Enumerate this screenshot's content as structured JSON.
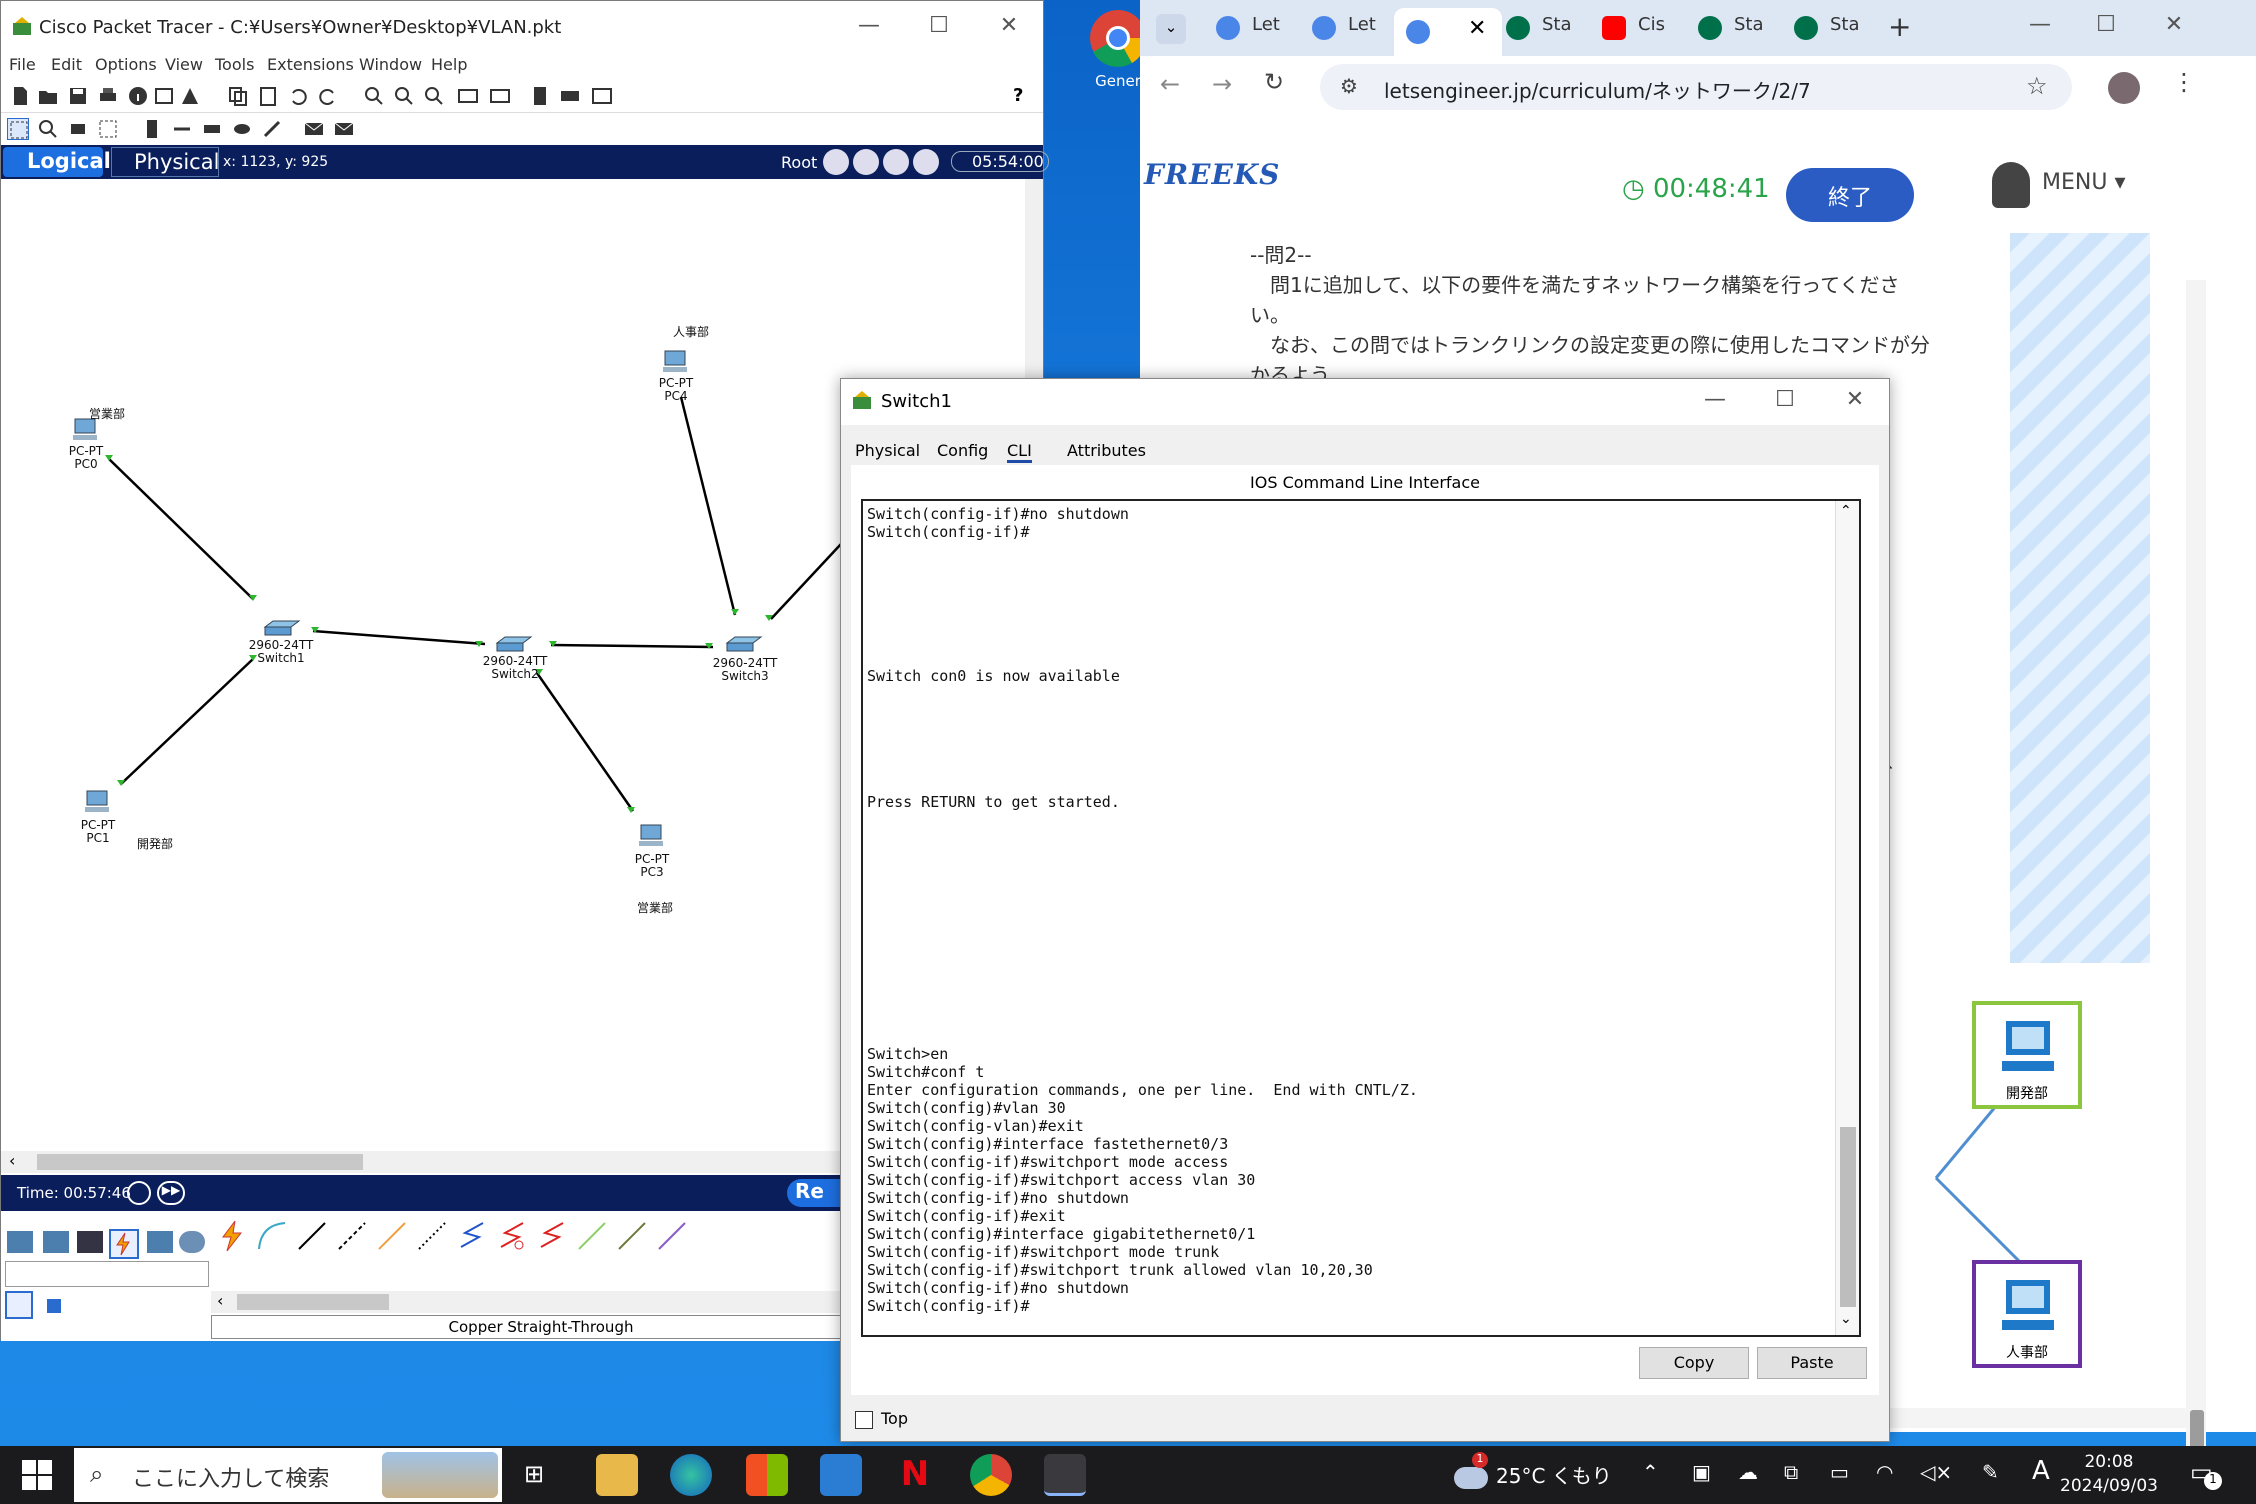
{
  "desktop": {
    "chrome_icon_label": "Gener"
  },
  "packet_tracer": {
    "title": "Cisco Packet Tracer - C:¥Users¥Owner¥Desktop¥VLAN.pkt",
    "menu": [
      "File",
      "Edit",
      "Options",
      "View",
      "Tools",
      "Extensions",
      "Window",
      "Help"
    ],
    "tab_logical": "Logical",
    "tab_physical": "Physical",
    "coords": "x: 1123, y: 925",
    "root": "Root",
    "clock": "05:54:00",
    "time": "Time: 00:57:46",
    "realtime_partial": "Re",
    "cable_label": "Copper Straight-Through",
    "devices": [
      {
        "model": "PC-PT",
        "name": "PC0",
        "dept": "営業部"
      },
      {
        "model": "PC-PT",
        "name": "PC1",
        "dept": "開発部"
      },
      {
        "model": "PC-PT",
        "name": "PC3",
        "dept": "営業部"
      },
      {
        "model": "PC-PT",
        "name": "PC4",
        "dept": "人事部"
      },
      {
        "model": "2960-24TT",
        "name": "Switch1"
      },
      {
        "model": "2960-24TT",
        "name": "Switch2"
      },
      {
        "model": "2960-24TT",
        "name": "Switch3"
      }
    ]
  },
  "chrome": {
    "tabs": [
      "Let",
      "Let",
      "",
      "Sta",
      "Cis",
      "Sta",
      "Sta"
    ],
    "url": "letsengineer.jp/curriculum/ネットワーク/2/7",
    "logo": "FREEKS",
    "timer": "00:48:41",
    "end_button": "終了",
    "menu_label": "MENU",
    "question_title": "--問2--",
    "question_line1": "問1に追加して、以下の要件を満たすネットワーク構築を行ってくださ",
    "question_line2": "い。",
    "question_line3": "なお、この問ではトランクリンクの設定変更の際に使用したコマンドが分",
    "question_line4": "かるよう",
    "fragment": "、",
    "netbox_dev": "開発部",
    "netbox_hr": "人事部",
    "colors": {
      "dev_border": "#8cc63f",
      "hr_border": "#6a2fa0",
      "link": "#4f8fd0"
    }
  },
  "switch_dialog": {
    "title": "Switch1",
    "tabs": [
      "Physical",
      "Config",
      "CLI",
      "Attributes"
    ],
    "active_tab": "CLI",
    "header": "IOS Command Line Interface",
    "cli_text": "Switch(config-if)#no shutdown\nSwitch(config-if)#\n\n\n\n\n\n\n\nSwitch con0 is now available\n\n\n\n\n\n\nPress RETURN to get started.\n\n\n\n\n\n\n\n\n\n\n\n\n\nSwitch>en\nSwitch#conf t\nEnter configuration commands, one per line.  End with CNTL/Z.\nSwitch(config)#vlan 30\nSwitch(config-vlan)#exit\nSwitch(config)#interface fastethernet0/3\nSwitch(config-if)#switchport mode access\nSwitch(config-if)#switchport access vlan 30\nSwitch(config-if)#no shutdown\nSwitch(config-if)#exit\nSwitch(config)#interface gigabitethernet0/1\nSwitch(config-if)#switchport mode trunk\nSwitch(config-if)#switchport trunk allowed vlan 10,20,30\nSwitch(config-if)#no shutdown\nSwitch(config-if)#",
    "copy_button": "Copy",
    "paste_button": "Paste",
    "top_checkbox": "Top"
  },
  "taskbar": {
    "search_placeholder": "ここに入力して検索",
    "weather": "25°C くもり",
    "weather_badge": "1",
    "tray_lang": "A",
    "time": "20:08",
    "date": "2024/09/03",
    "notif_count": "1"
  }
}
